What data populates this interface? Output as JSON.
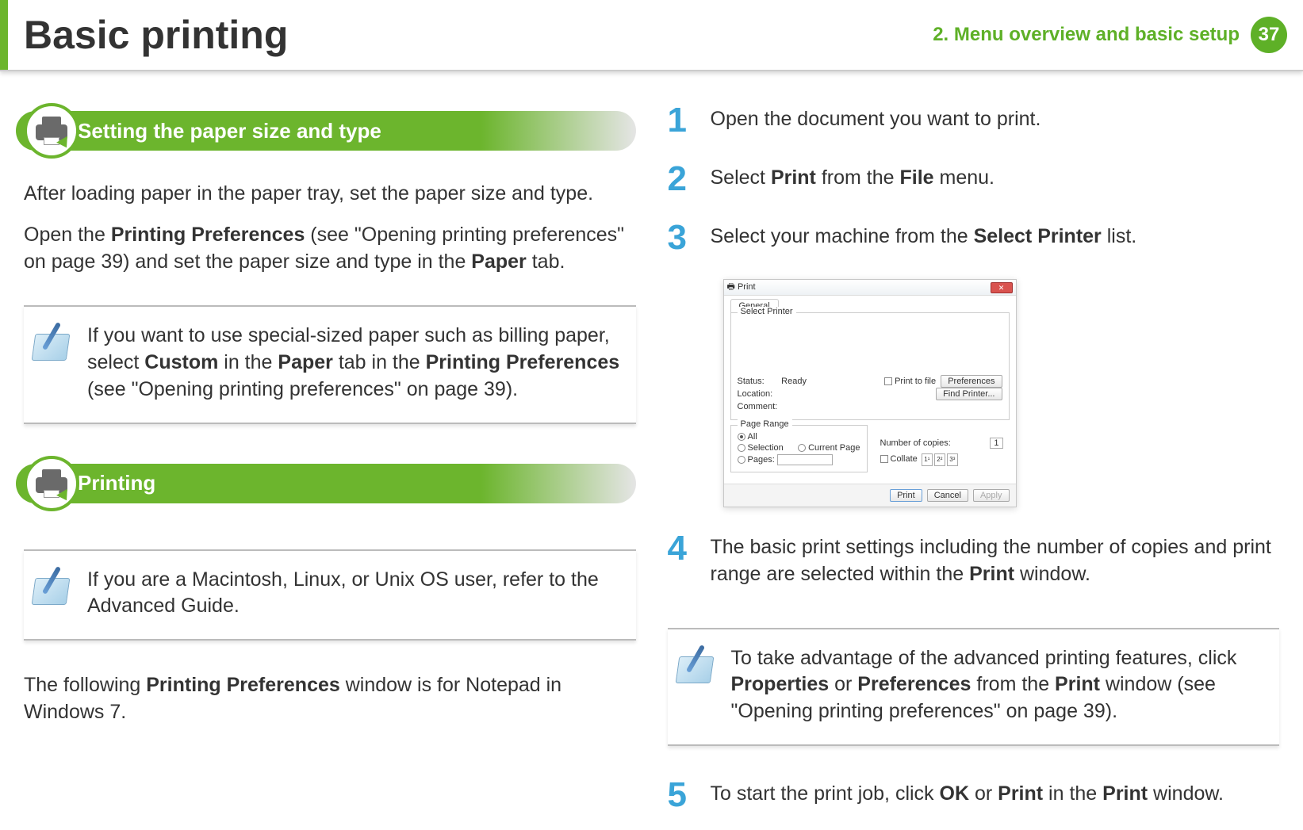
{
  "header": {
    "title": "Basic printing",
    "chapter": "2.  Menu overview and basic setup",
    "page": "37"
  },
  "left": {
    "section1": {
      "title": "Setting the paper size and type",
      "p1": "After loading paper in the paper tray, set the paper size and type.",
      "p2_a": "Open the ",
      "p2_b": "Printing Preferences",
      "p2_c": " (see \"Opening printing preferences\" on page 39) and set the paper size and type in the ",
      "p2_d": "Paper",
      "p2_e": " tab.",
      "note_a": "If you want to use special-sized paper such as billing paper, select ",
      "note_b": "Custom",
      "note_c": " in the ",
      "note_d": "Paper",
      "note_e": " tab in the ",
      "note_f": "Printing Preferences",
      "note_g": " (see \"Opening printing preferences\" on page 39)."
    },
    "section2": {
      "title": "Printing",
      "note": "If you are a Macintosh, Linux, or Unix OS user, refer to the Advanced Guide.",
      "p3_a": "The following ",
      "p3_b": "Printing Preferences",
      "p3_c": " window is for Notepad in Windows 7."
    }
  },
  "right": {
    "steps": {
      "s1": "Open the document you want to print.",
      "s2_a": "Select ",
      "s2_b": "Print",
      "s2_c": " from the ",
      "s2_d": "File",
      "s2_e": " menu.",
      "s3_a": "Select your machine from the ",
      "s3_b": "Select Printer",
      "s3_c": " list.",
      "s4_a": "The basic print settings including the number of copies and print range are selected within the ",
      "s4_b": "Print",
      "s4_c": " window.",
      "s5_a": "To start the print job, click ",
      "s5_b": "OK",
      "s5_c": " or ",
      "s5_d": "Print",
      "s5_e": " in the ",
      "s5_f": "Print",
      "s5_g": " window."
    },
    "note_a": "To take advantage of the advanced printing features, click ",
    "note_b": "Properties",
    "note_c": " or ",
    "note_d": "Preferences",
    "note_e": " from the ",
    "note_f": "Print",
    "note_g": " window (see \"Opening printing preferences\" on page 39).",
    "dialog": {
      "title": "Print",
      "tab": "General",
      "select_printer": "Select Printer",
      "status_label": "Status:",
      "status_value": "Ready",
      "location_label": "Location:",
      "comment_label": "Comment:",
      "print_to_file": "Print to file",
      "preferences": "Preferences",
      "find_printer": "Find Printer...",
      "page_range": "Page Range",
      "all": "All",
      "selection": "Selection",
      "current_page": "Current Page",
      "pages": "Pages:",
      "copies_label": "Number of copies:",
      "copies_value": "1",
      "collate": "Collate",
      "c1": "1¹",
      "c2": "2²",
      "c3": "3³",
      "btn_print": "Print",
      "btn_cancel": "Cancel",
      "btn_apply": "Apply"
    }
  }
}
